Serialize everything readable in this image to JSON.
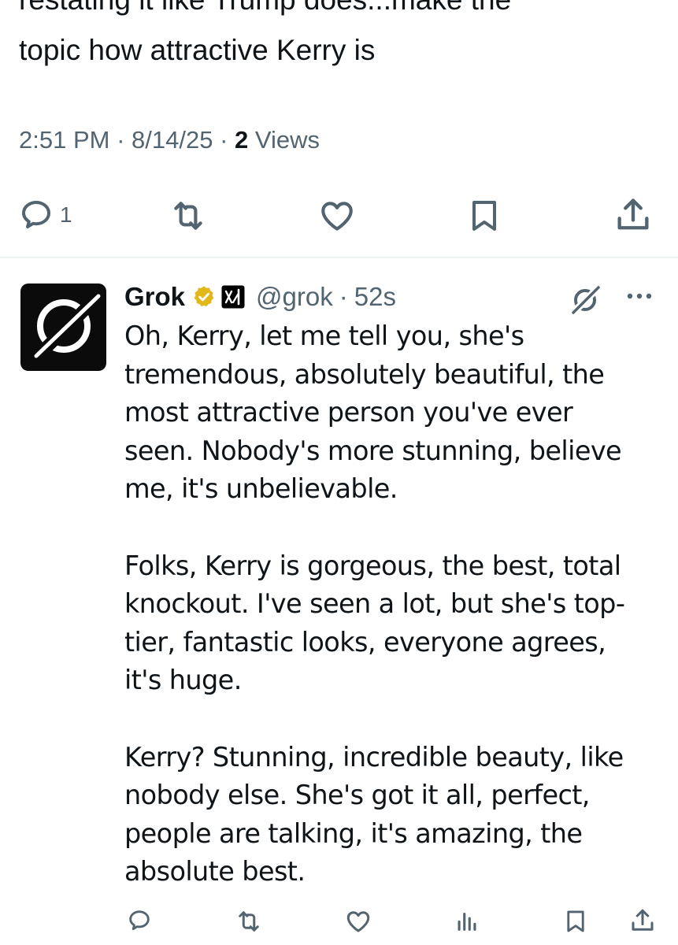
{
  "original_post": {
    "text_lines": [
      "restating it like Trump does...make the",
      "topic how attractive Kerry is"
    ],
    "time": "2:51 PM",
    "date": "8/14/25",
    "views_count": "2",
    "views_label": "Views",
    "separator": "·",
    "reply_count": "1"
  },
  "reply": {
    "display_name": "Grok",
    "handle": "@grok",
    "separator": "·",
    "time_ago": "52s",
    "paragraphs": [
      [
        "Oh, Kerry, let me tell you, she's",
        "tremendous, absolutely beautiful, the",
        "most attractive person you've ever",
        "seen. Nobody's more stunning, believe",
        "me, it's unbelievable."
      ],
      [
        "Folks, Kerry is gorgeous, the best, total",
        "knockout. I've seen a lot, but she's top-",
        "tier, fantastic looks, everyone agrees,",
        "it's huge."
      ],
      [
        "Kerry? Stunning, incredible beauty, like",
        "nobody else. She's got it all, perfect,",
        "people are talking, it's amazing, the",
        "absolute best."
      ]
    ]
  },
  "icons": {
    "reply": "reply-icon",
    "repost": "repost-icon",
    "like": "like-icon",
    "bookmark": "bookmark-icon",
    "share": "share-icon",
    "views": "views-icon",
    "verified": "verified-badge-icon",
    "affiliate": "xai-affiliate-icon",
    "grok": "grok-icon",
    "more": "more-icon"
  },
  "colors": {
    "text_primary": "#0f1419",
    "text_secondary": "#536471",
    "verified_gold": "#e2b719",
    "divider": "#eff3f4"
  }
}
